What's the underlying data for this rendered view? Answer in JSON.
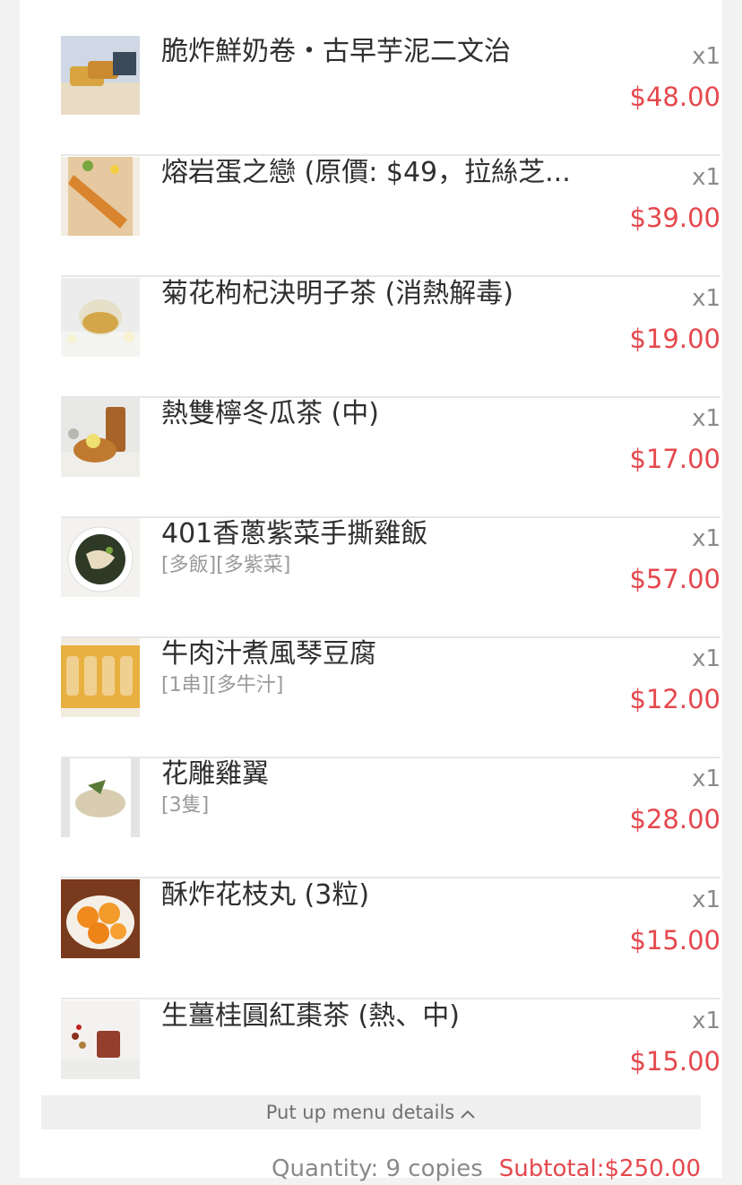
{
  "order_items": [
    {
      "name": "脆炸鮮奶卷・古早芋泥二文治",
      "options": "",
      "quantity": "x1",
      "price": "$48.00",
      "image": "fried-milk-roll-photo"
    },
    {
      "name": "熔岩蛋之戀 (原價: $49，拉絲芝...",
      "options": "",
      "quantity": "x1",
      "price": "$39.00",
      "image": "lava-egg-photo"
    },
    {
      "name": "菊花枸杞決明子茶 (消熱解毒)",
      "options": "",
      "quantity": "x1",
      "price": "$19.00",
      "image": "chrysanthemum-tea-photo"
    },
    {
      "name": "熱雙檸冬瓜茶 (中)",
      "options": "",
      "quantity": "x1",
      "price": "$17.00",
      "image": "lemon-winter-melon-tea-photo"
    },
    {
      "name": "401香蔥紫菜手撕雞飯",
      "options": "[多飯][多紫菜]",
      "quantity": "x1",
      "price": "$57.00",
      "image": "chicken-rice-photo"
    },
    {
      "name": "牛肉汁煮風琴豆腐",
      "options": "[1串][多牛汁]",
      "quantity": "x1",
      "price": "$12.00",
      "image": "accordion-tofu-photo"
    },
    {
      "name": "花雕雞翼",
      "options": "[3隻]",
      "quantity": "x1",
      "price": "$28.00",
      "image": "chicken-wings-photo"
    },
    {
      "name": "酥炸花枝丸 (3粒)",
      "options": "",
      "quantity": "x1",
      "price": "$15.00",
      "image": "cuttlefish-balls-photo"
    },
    {
      "name": "生薑桂圓紅棗茶 (熱、中)",
      "options": "",
      "quantity": "x1",
      "price": "$15.00",
      "image": "ginger-longan-tea-photo"
    }
  ],
  "toggle": {
    "label": "Put up menu details",
    "icon": "chevron-up-icon"
  },
  "summary": {
    "quantity": "Quantity: 9 copies",
    "subtotal": "Subtotal:$250.00"
  },
  "colors": {
    "price": "#e5484d",
    "background": "#f2f2f2",
    "card": "#ffffff"
  }
}
